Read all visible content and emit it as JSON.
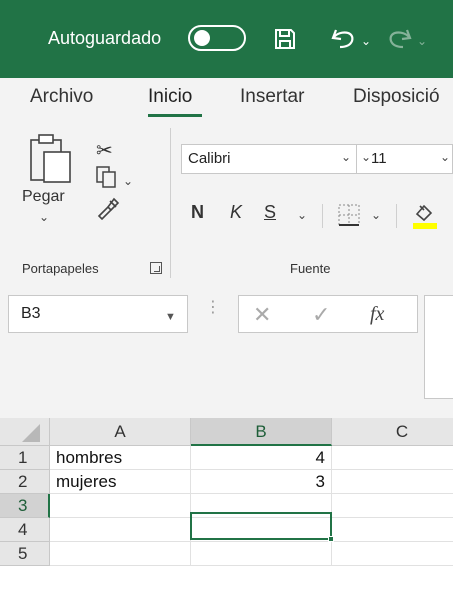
{
  "titlebar": {
    "autosave_label": "Autoguardado",
    "autosave_on": false,
    "accent": "#217346"
  },
  "tabs": [
    {
      "label": "Archivo"
    },
    {
      "label": "Inicio",
      "active": true
    },
    {
      "label": "Insertar"
    },
    {
      "label": "Disposició"
    }
  ],
  "ribbon": {
    "clipboard": {
      "paste_label": "Pegar",
      "group_label": "Portapapeles"
    },
    "font": {
      "font_name": "Calibri",
      "font_size": "11",
      "bold": "N",
      "italic": "K",
      "underline": "S",
      "group_label": "Fuente"
    }
  },
  "formula_bar": {
    "name_box": "B3",
    "fx_label": "fx",
    "formula": ""
  },
  "grid": {
    "columns": [
      "A",
      "B",
      "C"
    ],
    "selected_column": "B",
    "rows": [
      {
        "num": "1",
        "A": "hombres",
        "B": "4",
        "C": ""
      },
      {
        "num": "2",
        "A": "mujeres",
        "B": "3",
        "C": ""
      },
      {
        "num": "3",
        "A": "",
        "B": "",
        "C": ""
      },
      {
        "num": "4",
        "A": "",
        "B": "",
        "C": ""
      },
      {
        "num": "5",
        "A": "",
        "B": "",
        "C": ""
      }
    ],
    "selected_row": "3"
  }
}
